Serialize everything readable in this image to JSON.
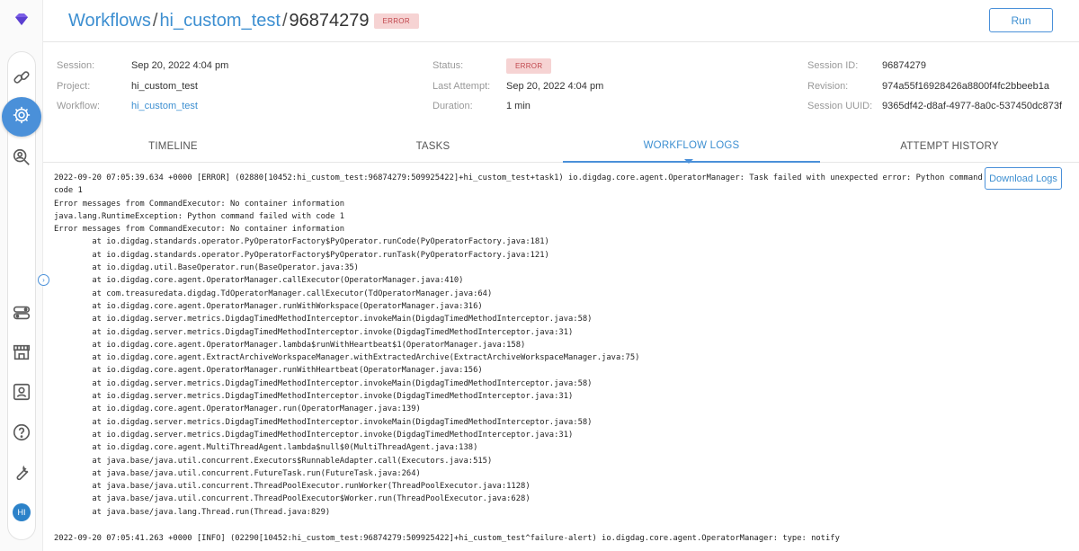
{
  "breadcrumb": {
    "workflows": "Workflows",
    "project": "hi_custom_test",
    "session_id": "96874279",
    "status": "ERROR",
    "sep": "/"
  },
  "run_button": "Run",
  "info": {
    "session_label": "Session:",
    "session_value": "Sep 20, 2022 4:04 pm",
    "project_label": "Project:",
    "project_value": "hi_custom_test",
    "workflow_label": "Workflow:",
    "workflow_value": "hi_custom_test",
    "status_label": "Status:",
    "status_value": "ERROR",
    "last_attempt_label": "Last Attempt:",
    "last_attempt_value": "Sep 20, 2022 4:04 pm",
    "duration_label": "Duration:",
    "duration_value": "1 min",
    "session_id_label": "Session ID:",
    "session_id_value": "96874279",
    "revision_label": "Revision:",
    "revision_value": "974a55f16928426a8800f4fc2bbeeb1a",
    "session_uuid_label": "Session UUID:",
    "session_uuid_value": "9365df42-d8af-4977-8a0c-537450dc873f"
  },
  "tabs": [
    "TIMELINE",
    "TASKS",
    "WORKFLOW LOGS",
    "ATTEMPT HISTORY"
  ],
  "download_logs": "Download Logs",
  "avatar": "HI",
  "sidebar_icons": [
    "diamond-logo-icon",
    "link-icon",
    "workflow-gear-icon",
    "search-person-icon",
    "toggles-icon",
    "storefront-icon",
    "user-card-icon",
    "help-icon",
    "wrench-icon"
  ],
  "accent_color": "#4a90d9",
  "logs": [
    "2022-09-20 07:05:39.634 +0000 [ERROR] (02880[10452:hi_custom_test:96874279:509925422]+hi_custom_test+task1) io.digdag.core.agent.OperatorManager: Task failed with unexpected error: Python command failed with",
    "code 1",
    "Error messages from CommandExecutor: No container information",
    "java.lang.RuntimeException: Python command failed with code 1",
    "Error messages from CommandExecutor: No container information",
    "        at io.digdag.standards.operator.PyOperatorFactory$PyOperator.runCode(PyOperatorFactory.java:181)",
    "        at io.digdag.standards.operator.PyOperatorFactory$PyOperator.runTask(PyOperatorFactory.java:121)",
    "        at io.digdag.util.BaseOperator.run(BaseOperator.java:35)",
    "        at io.digdag.core.agent.OperatorManager.callExecutor(OperatorManager.java:410)",
    "        at com.treasuredata.digdag.TdOperatorManager.callExecutor(TdOperatorManager.java:64)",
    "        at io.digdag.core.agent.OperatorManager.runWithWorkspace(OperatorManager.java:316)",
    "        at io.digdag.server.metrics.DigdagTimedMethodInterceptor.invokeMain(DigdagTimedMethodInterceptor.java:58)",
    "        at io.digdag.server.metrics.DigdagTimedMethodInterceptor.invoke(DigdagTimedMethodInterceptor.java:31)",
    "        at io.digdag.core.agent.OperatorManager.lambda$runWithHeartbeat$1(OperatorManager.java:158)",
    "        at io.digdag.core.agent.ExtractArchiveWorkspaceManager.withExtractedArchive(ExtractArchiveWorkspaceManager.java:75)",
    "        at io.digdag.core.agent.OperatorManager.runWithHeartbeat(OperatorManager.java:156)",
    "        at io.digdag.server.metrics.DigdagTimedMethodInterceptor.invokeMain(DigdagTimedMethodInterceptor.java:58)",
    "        at io.digdag.server.metrics.DigdagTimedMethodInterceptor.invoke(DigdagTimedMethodInterceptor.java:31)",
    "        at io.digdag.core.agent.OperatorManager.run(OperatorManager.java:139)",
    "        at io.digdag.server.metrics.DigdagTimedMethodInterceptor.invokeMain(DigdagTimedMethodInterceptor.java:58)",
    "        at io.digdag.server.metrics.DigdagTimedMethodInterceptor.invoke(DigdagTimedMethodInterceptor.java:31)",
    "        at io.digdag.core.agent.MultiThreadAgent.lambda$null$0(MultiThreadAgent.java:138)",
    "        at java.base/java.util.concurrent.Executors$RunnableAdapter.call(Executors.java:515)",
    "        at java.base/java.util.concurrent.FutureTask.run(FutureTask.java:264)",
    "        at java.base/java.util.concurrent.ThreadPoolExecutor.runWorker(ThreadPoolExecutor.java:1128)",
    "        at java.base/java.util.concurrent.ThreadPoolExecutor$Worker.run(ThreadPoolExecutor.java:628)",
    "        at java.base/java.lang.Thread.run(Thread.java:829)"
  ],
  "logs_after": [
    "2022-09-20 07:05:41.263 +0000 [INFO] (02290[10452:hi_custom_test:96874279:509925422]+hi_custom_test^failure-alert) io.digdag.core.agent.OperatorManager: type: notify"
  ]
}
